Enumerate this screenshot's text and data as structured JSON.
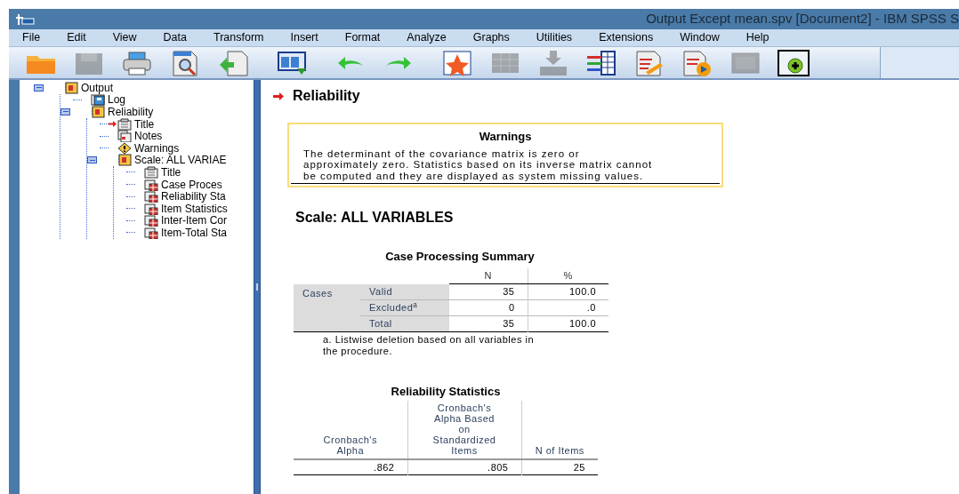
{
  "window": {
    "title": "Output Except mean.spv [Document2] - IBM SPSS S"
  },
  "menu": [
    "File",
    "Edit",
    "View",
    "Data",
    "Transform",
    "Insert",
    "Format",
    "Analyze",
    "Graphs",
    "Utilities",
    "Extensions",
    "Window",
    "Help"
  ],
  "toolbar": [
    {
      "kind": "folder",
      "disabled": false
    },
    {
      "kind": "save",
      "disabled": true
    },
    {
      "kind": "print",
      "disabled": false
    },
    {
      "kind": "preview",
      "disabled": false
    },
    {
      "kind": "export",
      "disabled": false
    },
    {
      "kind": "window",
      "disabled": false
    },
    {
      "kind": "undo",
      "disabled": false
    },
    {
      "kind": "redo",
      "disabled": false
    },
    {
      "kind": "startable",
      "disabled": false
    },
    {
      "kind": "grid",
      "disabled": true
    },
    {
      "kind": "download",
      "disabled": true
    },
    {
      "kind": "listtable",
      "disabled": false
    },
    {
      "kind": "docpen",
      "disabled": false
    },
    {
      "kind": "docplay",
      "disabled": false
    },
    {
      "kind": "frame",
      "disabled": true
    },
    {
      "kind": "plus",
      "disabled": false
    }
  ],
  "outline": [
    {
      "label": "Output",
      "kind": "book",
      "expanded": true,
      "selected": false,
      "children": [
        {
          "label": "Log",
          "kind": "log",
          "selected": false
        },
        {
          "label": "Reliability",
          "kind": "book",
          "expanded": true,
          "selected": false,
          "children": [
            {
              "label": "Title",
              "kind": "title",
              "selected": true
            },
            {
              "label": "Notes",
              "kind": "notes",
              "selected": false
            },
            {
              "label": "Warnings",
              "kind": "warning",
              "selected": false
            },
            {
              "label": "Scale: ALL VARIAE",
              "kind": "book",
              "expanded": true,
              "selected": false,
              "children": [
                {
                  "label": "Title",
                  "kind": "title",
                  "selected": false
                },
                {
                  "label": "Case Proces",
                  "kind": "table",
                  "selected": false
                },
                {
                  "label": "Reliability Sta",
                  "kind": "table",
                  "selected": false
                },
                {
                  "label": "Item Statistics",
                  "kind": "table",
                  "selected": false
                },
                {
                  "label": "Inter-Item Cor",
                  "kind": "table",
                  "selected": false
                },
                {
                  "label": "Item-Total Sta",
                  "kind": "table",
                  "selected": false
                }
              ]
            }
          ]
        }
      ]
    }
  ],
  "output": {
    "heading": "Reliability",
    "warnings": {
      "title": "Warnings",
      "text": "The determinant of the covariance matrix is zero or approximately zero. Statistics based on its inverse matrix cannot be computed and they are displayed as system missing values."
    },
    "scale_heading": "Scale: ALL VARIABLES",
    "case_processing_summary": {
      "title": "Case Processing Summary",
      "columns": [
        "N",
        "%"
      ],
      "group": "Cases",
      "rows": [
        {
          "label": "Valid",
          "n": "35",
          "pct": "100.0"
        },
        {
          "label": "Excluded$^{a}$",
          "n": "0",
          "pct": ".0"
        },
        {
          "label": "Total",
          "n": "35",
          "pct": "100.0"
        }
      ],
      "footnote": "a. Listwise deletion based on all variables in the procedure."
    },
    "reliability_statistics": {
      "title": "Reliability Statistics",
      "columns": [
        "Cronbach's Alpha",
        "Cronbach's Alpha Based on Standardized Items",
        "N of Items"
      ],
      "values": [
        ".862",
        ".805",
        "25"
      ]
    }
  }
}
